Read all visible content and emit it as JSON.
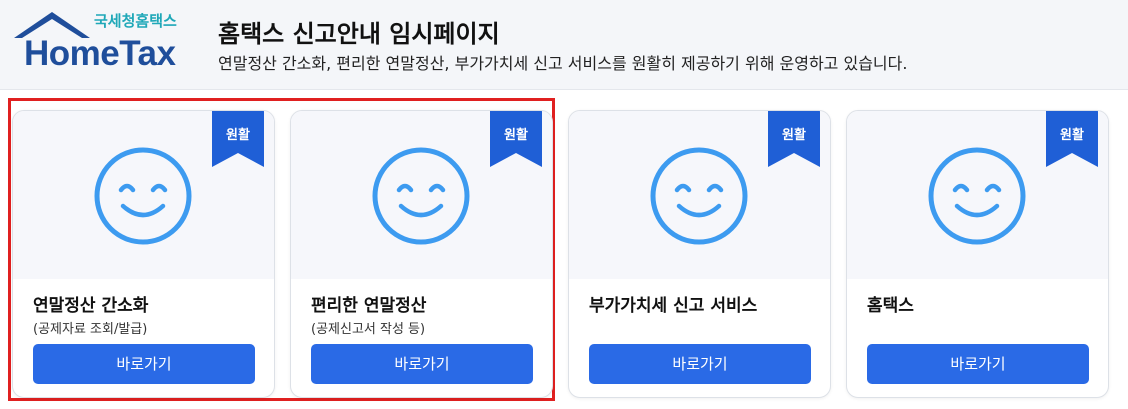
{
  "logo": {
    "subtitle": "국세청홈택스",
    "name": "HomeTax",
    "icon": "house-roof-icon"
  },
  "header": {
    "title": "홈택스 신고안내 임시페이지",
    "description": "연말정산 간소화, 편리한 연말정산, 부가가치세 신고 서비스를 원활히 제공하기 위해 운영하고 있습니다."
  },
  "colors": {
    "accent": "#2a6ae6",
    "ribbon": "#1f5fd6",
    "highlight": "#e02020",
    "face": "#3d9bf0"
  },
  "cards": [
    {
      "status": "원활",
      "title": "연말정산 간소화",
      "subtitle": "(공제자료 조회/발급)",
      "button": "바로가기",
      "icon": "smiley-face-icon"
    },
    {
      "status": "원활",
      "title": "편리한 연말정산",
      "subtitle": "(공제신고서 작성 등)",
      "button": "바로가기",
      "icon": "smiley-face-icon"
    },
    {
      "status": "원활",
      "title": "부가가치세 신고 서비스",
      "subtitle": "",
      "button": "바로가기",
      "icon": "smiley-face-icon"
    },
    {
      "status": "원활",
      "title": "홈택스",
      "subtitle": "",
      "button": "바로가기",
      "icon": "smiley-face-icon"
    }
  ]
}
